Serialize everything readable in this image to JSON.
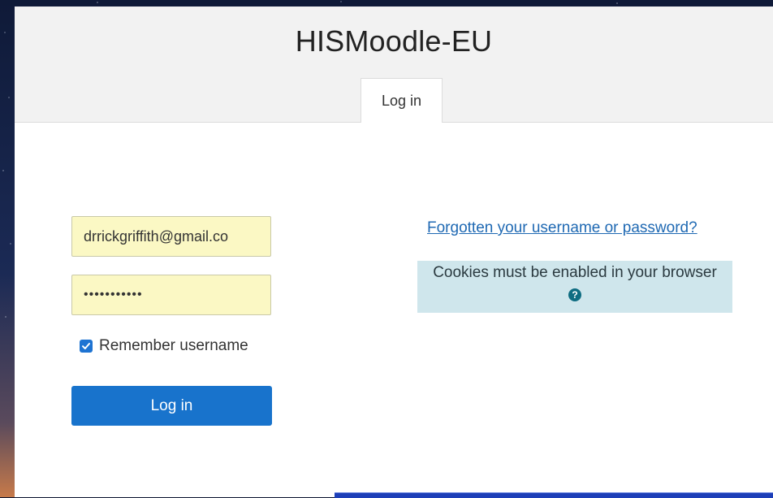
{
  "site": {
    "title": "HISMoodle-EU"
  },
  "tabs": [
    {
      "label": "Log in"
    }
  ],
  "login": {
    "username_value": "drrickgriffith@gmail.co",
    "password_value": "•••••••••••",
    "remember_label": "Remember username",
    "remember_checked": true,
    "button_label": "Log in"
  },
  "help": {
    "forgot_link": "Forgotten your username or password?",
    "cookies_notice": "Cookies must be enabled in your browser",
    "help_icon": "question-circle-icon"
  },
  "colors": {
    "primary": "#1873cc",
    "link": "#1f69b3",
    "autofill": "#fbf8c4",
    "notice_bg": "#cfe6ec",
    "help_icon": "#0f6d82"
  }
}
